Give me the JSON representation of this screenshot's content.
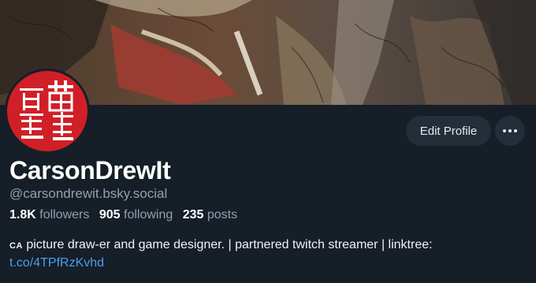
{
  "profile": {
    "display_name": "CarsonDrewIt",
    "handle": "@carsondrewit.bsky.social",
    "stats": {
      "followers_count": "1.8K",
      "followers_label": "followers",
      "following_count": "905",
      "following_label": "following",
      "posts_count": "235",
      "posts_label": "posts"
    },
    "bio_flag": "CA",
    "bio_text": "picture draw-er and game designer. | partnered twitch streamer | linktree:",
    "bio_link": "t.co/4TPfRzKvhd",
    "avatar_seal_text": [
      "黃",
      "馬"
    ]
  },
  "actions": {
    "edit_profile_label": "Edit Profile",
    "more_icon": "ellipsis-icon"
  },
  "colors": {
    "background": "#161e27",
    "button_bg": "#242e39",
    "link": "#4a9ff0",
    "muted": "#93a0ae",
    "avatar_red": "#d11f27"
  }
}
